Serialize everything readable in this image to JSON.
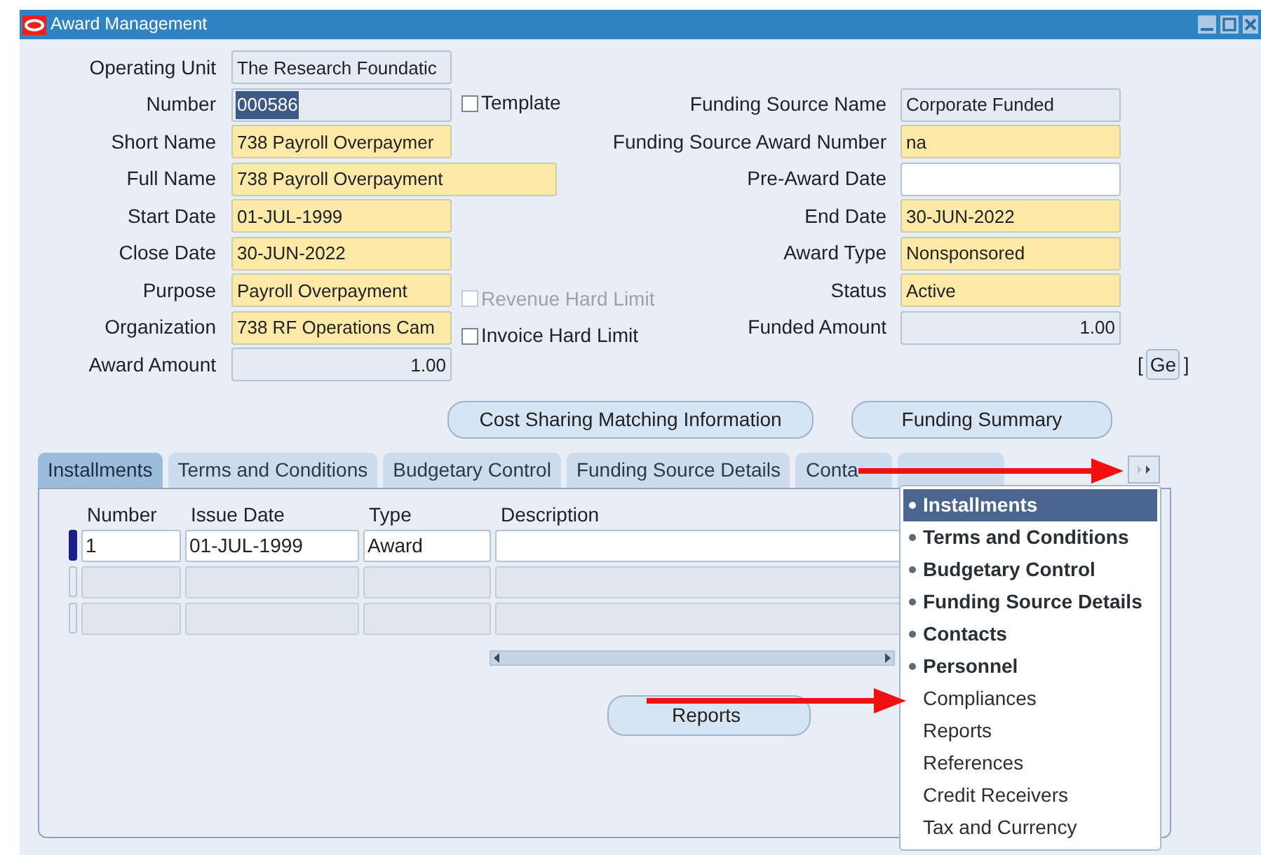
{
  "window": {
    "title": "Award Management"
  },
  "rows": [
    {
      "left": {
        "label": "Operating Unit",
        "value": "The Research Foundatic",
        "kind": "readonly",
        "text_selected": false
      }
    },
    {
      "left": {
        "label": "Number",
        "value": "000586",
        "kind": "readonly",
        "text_selected": true
      },
      "checkbox": {
        "label": "Template",
        "checked": false,
        "disabled": false
      },
      "right": {
        "label": "Funding Source Name",
        "value": "Corporate Funded",
        "kind": "readonly",
        "text_selected": false
      }
    },
    {
      "left": {
        "label": "Short Name",
        "value": "738 Payroll Overpaymer",
        "kind": "required",
        "text_selected": false
      },
      "right": {
        "label": "Funding Source Award Number",
        "value": "na",
        "kind": "required",
        "text_selected": false
      }
    },
    {
      "left": {
        "label": "Full Name",
        "value": "738 Payroll Overpayment",
        "kind": "wide",
        "text_selected": false
      },
      "right": {
        "label": "Pre-Award Date",
        "kind": "blank"
      }
    },
    {
      "left": {
        "label": "Start Date",
        "value": "01-JUL-1999",
        "kind": "required",
        "text_selected": false
      },
      "right": {
        "label": "End Date",
        "value": "30-JUN-2022",
        "kind": "required",
        "text_selected": false
      }
    },
    {
      "left": {
        "label": "Close Date",
        "value": "30-JUN-2022",
        "kind": "required",
        "text_selected": false
      },
      "right": {
        "label": "Award Type",
        "value": "Nonsponsored",
        "kind": "required",
        "text_selected": false
      }
    },
    {
      "left": {
        "label": "Purpose",
        "value": "Payroll Overpayment",
        "kind": "required",
        "text_selected": false
      },
      "checkbox": {
        "label": "Revenue Hard Limit",
        "checked": false,
        "disabled": true
      },
      "right": {
        "label": "Status",
        "value": "Active",
        "kind": "required",
        "text_selected": false
      }
    },
    {
      "left": {
        "label": "Organization",
        "value": "738 RF Operations Cam",
        "kind": "required",
        "text_selected": false
      },
      "checkbox": {
        "label": "Invoice Hard Limit",
        "checked": false,
        "disabled": false
      },
      "right": {
        "label": "Funded Amount",
        "value": "1.00",
        "kind": "amount",
        "text_selected": false
      }
    },
    {
      "left": {
        "label": "Award Amount",
        "value": "1.00",
        "kind": "amount",
        "text_selected": false
      },
      "more": {
        "open": "[",
        "label": "Ge",
        "close": "]"
      }
    }
  ],
  "actions": [
    {
      "label": "Cost Sharing Matching Information"
    },
    {
      "label": "Funding Summary"
    }
  ],
  "tabs": [
    {
      "label": "Installments",
      "selected": true
    },
    {
      "label": "Terms and Conditions",
      "selected": false
    },
    {
      "label": "Budgetary Control",
      "selected": false
    },
    {
      "label": "Funding Source Details",
      "selected": false
    },
    {
      "label": "Conta",
      "selected": false
    },
    {
      "selected": false
    }
  ],
  "table": {
    "columns": [
      "Number",
      "Issue Date",
      "Type",
      "Description"
    ],
    "rows": [
      {
        "current": true,
        "number": "1",
        "issue_date": "01-JUL-1999",
        "type": "Award"
      },
      {
        "current": false
      },
      {
        "current": false
      }
    ]
  },
  "report_button": {
    "label": "Reports"
  },
  "tab_menu": {
    "items": [
      {
        "label": "Installments",
        "kind": "tab",
        "selected": true
      },
      {
        "label": "Terms and Conditions",
        "kind": "tab",
        "selected": false
      },
      {
        "label": "Budgetary Control",
        "kind": "tab",
        "selected": false
      },
      {
        "label": "Funding Source Details",
        "kind": "tab",
        "selected": false
      },
      {
        "label": "Contacts",
        "kind": "tab",
        "selected": false
      },
      {
        "label": "Personnel",
        "kind": "tab",
        "selected": false
      },
      {
        "label": "Compliances",
        "kind": "plain",
        "selected": false
      },
      {
        "label": "Reports",
        "kind": "plain",
        "selected": false
      },
      {
        "label": "References",
        "kind": "plain",
        "selected": false
      },
      {
        "label": "Credit Receivers",
        "kind": "plain",
        "selected": false
      },
      {
        "label": "Tax and Currency",
        "kind": "plain",
        "selected": false
      }
    ]
  }
}
